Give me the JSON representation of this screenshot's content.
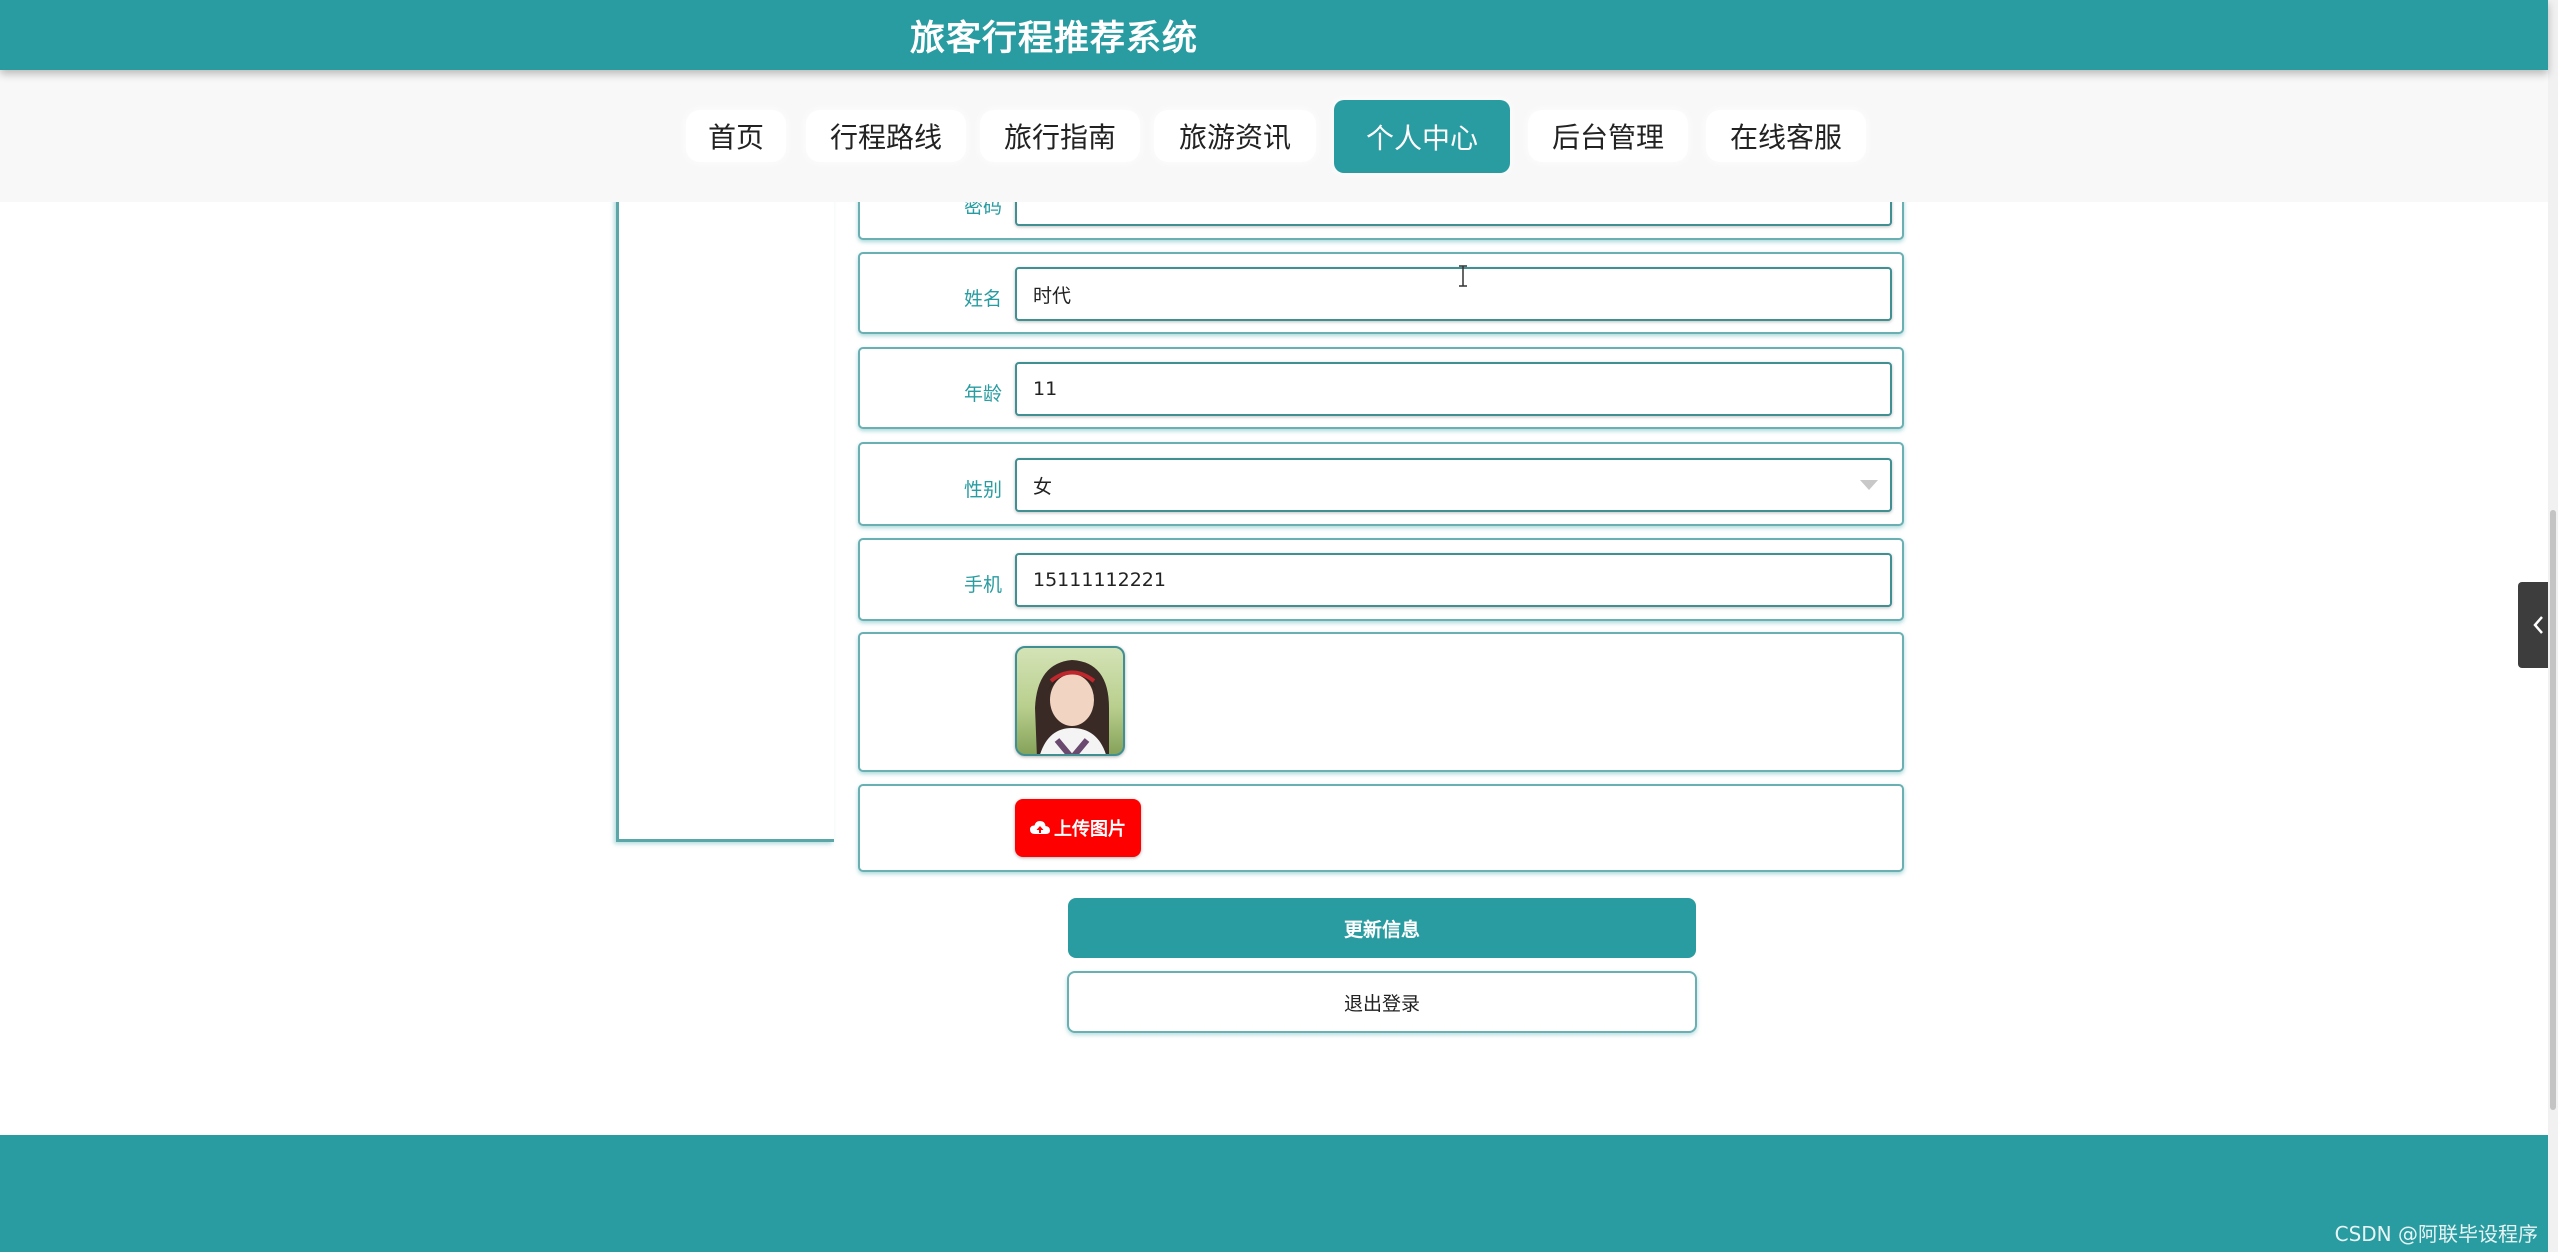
{
  "header": {
    "title": "旅客行程推荐系统"
  },
  "nav": {
    "items": [
      {
        "label": "首页",
        "active": false
      },
      {
        "label": "行程路线",
        "active": false
      },
      {
        "label": "旅行指南",
        "active": false
      },
      {
        "label": "旅游资讯",
        "active": false
      },
      {
        "label": "个人中心",
        "active": true
      },
      {
        "label": "后台管理",
        "active": false
      },
      {
        "label": "在线客服",
        "active": false
      }
    ]
  },
  "form": {
    "partial_label": "密码",
    "name": {
      "label": "姓名",
      "value": "时代"
    },
    "age": {
      "label": "年龄",
      "value": "11"
    },
    "gender": {
      "label": "性别",
      "value": "女"
    },
    "phone": {
      "label": "手机",
      "value": "15111112221"
    },
    "upload_label": "上传图片"
  },
  "actions": {
    "update_label": "更新信息",
    "logout_label": "退出登录"
  },
  "footer": {
    "watermark": "CSDN @阿联毕设程序"
  },
  "colors": {
    "primary": "#289ca1",
    "upload": "#ff0000"
  }
}
